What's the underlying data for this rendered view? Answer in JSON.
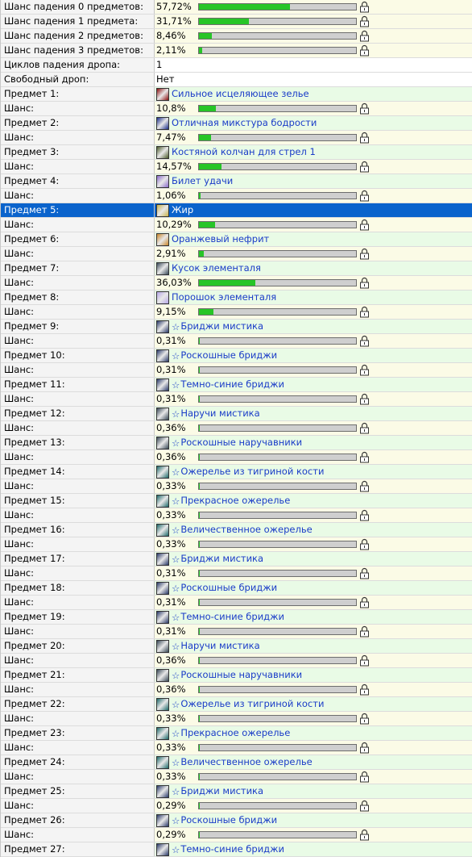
{
  "probabilities": [
    {
      "label": "Шанс падения 0 предметов:",
      "pct": "57,72%",
      "value": 0.5772
    },
    {
      "label": "Шанс падения 1 предмета:",
      "pct": "31,71%",
      "value": 0.3171
    },
    {
      "label": "Шанс падения 2 предметов:",
      "pct": "8,46%",
      "value": 0.0846
    },
    {
      "label": "Шанс падения 3 предметов:",
      "pct": "2,11%",
      "value": 0.0211
    }
  ],
  "cycles": {
    "label": "Циклов падения дропа:",
    "value": "1"
  },
  "free_drop": {
    "label": "Свободный дроп:",
    "value": "Нет"
  },
  "chance_label": "Шанс:",
  "selected_item": 5,
  "icon_colors": {
    "potion-red": "#8c1010",
    "potion-blue": "#1c2f8a",
    "quiver": "#4a5a2a",
    "ticket": "#8a6acb",
    "fat": "#c9b24a",
    "jade": "#c9852a",
    "elemental": "#3a4a5a",
    "powder": "#b6a6e8",
    "pants": "#2a3a6a",
    "bracers": "#3a4a58",
    "necklace": "#1e6a6a"
  },
  "items": [
    {
      "label": "Предмет 1:",
      "name": "Сильное исцеляющее зелье",
      "icon": "potion-red",
      "starred": false,
      "pct": "10,8%",
      "value": 0.108
    },
    {
      "label": "Предмет 2:",
      "name": "Отличная микстура бодрости",
      "icon": "potion-blue",
      "starred": false,
      "pct": "7,47%",
      "value": 0.0747
    },
    {
      "label": "Предмет 3:",
      "name": "Костяной колчан для стрел 1",
      "icon": "quiver",
      "starred": false,
      "pct": "14,57%",
      "value": 0.1457
    },
    {
      "label": "Предмет 4:",
      "name": "Билет удачи",
      "icon": "ticket",
      "starred": false,
      "pct": "1,06%",
      "value": 0.0106
    },
    {
      "label": "Предмет 5:",
      "name": "Жир",
      "icon": "fat",
      "starred": false,
      "pct": "10,29%",
      "value": 0.1029
    },
    {
      "label": "Предмет 6:",
      "name": "Оранжевый нефрит",
      "icon": "jade",
      "starred": false,
      "pct": "2,91%",
      "value": 0.0291
    },
    {
      "label": "Предмет 7:",
      "name": "Кусок элементаля",
      "icon": "elemental",
      "starred": false,
      "pct": "36,03%",
      "value": 0.3603
    },
    {
      "label": "Предмет 8:",
      "name": "Порошок элементаля",
      "icon": "powder",
      "starred": false,
      "pct": "9,15%",
      "value": 0.0915
    },
    {
      "label": "Предмет 9:",
      "name": "Бриджи мистика",
      "icon": "pants",
      "starred": true,
      "pct": "0,31%",
      "value": 0.0031
    },
    {
      "label": "Предмет 10:",
      "name": "Роскошные бриджи",
      "icon": "pants",
      "starred": true,
      "pct": "0,31%",
      "value": 0.0031
    },
    {
      "label": "Предмет 11:",
      "name": "Темно-синие бриджи",
      "icon": "pants",
      "starred": true,
      "pct": "0,31%",
      "value": 0.0031
    },
    {
      "label": "Предмет 12:",
      "name": "Наручи мистика",
      "icon": "bracers",
      "starred": true,
      "pct": "0,36%",
      "value": 0.0036
    },
    {
      "label": "Предмет 13:",
      "name": "Роскошные наручавники",
      "icon": "bracers",
      "starred": true,
      "pct": "0,36%",
      "value": 0.0036
    },
    {
      "label": "Предмет 14:",
      "name": "Ожерелье из тигриной кости",
      "icon": "necklace",
      "starred": true,
      "pct": "0,33%",
      "value": 0.0033
    },
    {
      "label": "Предмет 15:",
      "name": "Прекрасное ожерелье",
      "icon": "necklace",
      "starred": true,
      "pct": "0,33%",
      "value": 0.0033
    },
    {
      "label": "Предмет 16:",
      "name": "Величественное ожерелье",
      "icon": "necklace",
      "starred": true,
      "pct": "0,33%",
      "value": 0.0033
    },
    {
      "label": "Предмет 17:",
      "name": "Бриджи мистика",
      "icon": "pants",
      "starred": true,
      "pct": "0,31%",
      "value": 0.0031
    },
    {
      "label": "Предмет 18:",
      "name": "Роскошные бриджи",
      "icon": "pants",
      "starred": true,
      "pct": "0,31%",
      "value": 0.0031
    },
    {
      "label": "Предмет 19:",
      "name": "Темно-синие бриджи",
      "icon": "pants",
      "starred": true,
      "pct": "0,31%",
      "value": 0.0031
    },
    {
      "label": "Предмет 20:",
      "name": "Наручи мистика",
      "icon": "bracers",
      "starred": true,
      "pct": "0,36%",
      "value": 0.0036
    },
    {
      "label": "Предмет 21:",
      "name": "Роскошные наручавники",
      "icon": "bracers",
      "starred": true,
      "pct": "0,36%",
      "value": 0.0036
    },
    {
      "label": "Предмет 22:",
      "name": "Ожерелье из тигриной кости",
      "icon": "necklace",
      "starred": true,
      "pct": "0,33%",
      "value": 0.0033
    },
    {
      "label": "Предмет 23:",
      "name": "Прекрасное ожерелье",
      "icon": "necklace",
      "starred": true,
      "pct": "0,33%",
      "value": 0.0033
    },
    {
      "label": "Предмет 24:",
      "name": "Величественное ожерелье",
      "icon": "necklace",
      "starred": true,
      "pct": "0,33%",
      "value": 0.0033
    },
    {
      "label": "Предмет 25:",
      "name": "Бриджи мистика",
      "icon": "pants",
      "starred": true,
      "pct": "0,29%",
      "value": 0.0029
    },
    {
      "label": "Предмет 26:",
      "name": "Роскошные бриджи",
      "icon": "pants",
      "starred": true,
      "pct": "0,29%",
      "value": 0.0029
    },
    {
      "label": "Предмет 27:",
      "name": "Темно-синие бриджи",
      "icon": "pants",
      "starred": true
    }
  ]
}
